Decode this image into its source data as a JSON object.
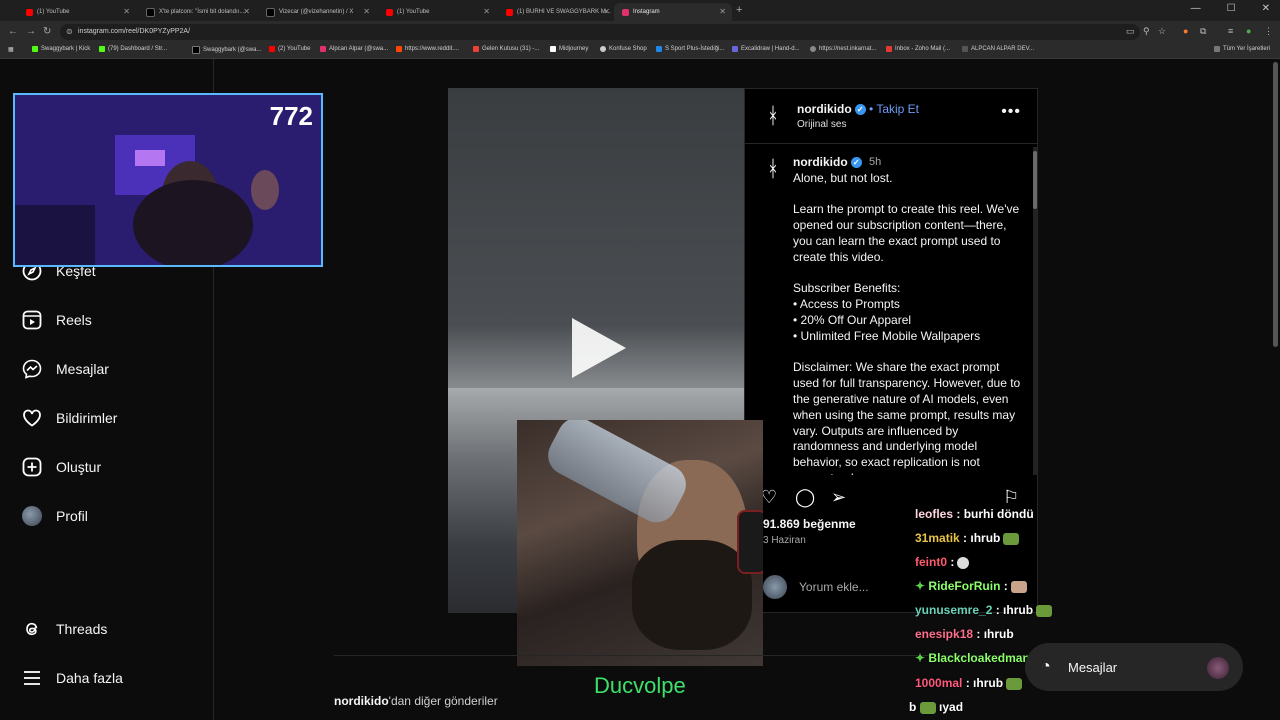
{
  "browser": {
    "tabs": [
      {
        "title": "(1) YouTube",
        "icon": "youtube-icon",
        "color": "#ff0000"
      },
      {
        "title": "X'te platconı: \"İsmi bit dolandıı...",
        "icon": "x-icon",
        "color": "#000000"
      },
      {
        "title": "Vizecar (@vizehannetin) / X",
        "icon": "x-icon",
        "color": "#000000"
      },
      {
        "title": "(1) YouTube",
        "icon": "youtube-icon",
        "color": "#ff0000"
      },
      {
        "title": "(1) BURHI VE SWAGGYBARK M...",
        "icon": "youtube-icon",
        "color": "#ff0000"
      },
      {
        "title": "Instagram",
        "icon": "instagram-icon",
        "color": "#e1306c"
      }
    ],
    "url": "instagram.com/reel/DK0PYZyPP2A/",
    "bookmarks": [
      {
        "label": "Swaggybark | Kick",
        "color": "#53fc18"
      },
      {
        "label": "(79) Dashboard / Str...",
        "color": "#53fc18"
      },
      {
        "label": "Swaggybark (@swa...",
        "color": "#000000"
      },
      {
        "label": "(2) YouTube",
        "color": "#ff0000"
      },
      {
        "label": "Alpcan Alpar (@swa...",
        "color": "#e1306c"
      },
      {
        "label": "https://www.reddit....",
        "color": "#ff4500"
      },
      {
        "label": "Gelen Kutusu (31) -...",
        "color": "#ea4335"
      },
      {
        "label": "Midjourney",
        "color": "#ffffff"
      },
      {
        "label": "Konfuse Shop",
        "color": "#cccccc"
      },
      {
        "label": "S Sport Plus-İstediği...",
        "color": "#1e88e5"
      },
      {
        "label": "Excalidraw | Hand-d...",
        "color": "#6965db"
      },
      {
        "label": "https://nest.inkarnat...",
        "color": "#888888"
      },
      {
        "label": "Inbox - Zoho Mail (...",
        "color": "#e53935"
      },
      {
        "label": "ALPCAN ALPAR DEV...",
        "color": "#555555"
      }
    ],
    "all_bookmarks": "Tüm Yer İşaretleri"
  },
  "sidebar": {
    "items": [
      {
        "label": "Keşfet",
        "icon": "compass-icon"
      },
      {
        "label": "Reels",
        "icon": "reels-icon"
      },
      {
        "label": "Mesajlar",
        "icon": "messenger-icon"
      },
      {
        "label": "Bildirimler",
        "icon": "heart-icon"
      },
      {
        "label": "Oluştur",
        "icon": "plus-square-icon"
      },
      {
        "label": "Profil",
        "icon": "avatar"
      }
    ],
    "threads": "Threads",
    "more": "Daha fazla"
  },
  "webcam": {
    "viewer_count": "772"
  },
  "post": {
    "username": "nordikido",
    "follow": "Takip Et",
    "audio": "Orijinal ses",
    "time": "5h",
    "caption": "Alone, but not lost.\n\nLearn the prompt to create this reel. We've opened our subscription content—there, you can learn the exact prompt used to create this video.\n\nSubscriber Benefits:\n• Access to Prompts\n• 20% Off Our Apparel\n• Unlimited Free Mobile Wallpapers\n\nDisclaimer: We share the exact prompt used for full transparency. However, due to the generative nature of AI models, even when using the same prompt, results may vary. Outputs are influenced by randomness and underlying model behavior, so exact replication is not guaranteed.",
    "likes": "91.869 beğenme",
    "date": "3 Haziran",
    "comment_placeholder": "Yorum ekle..."
  },
  "more_posts": {
    "user": "nordikido",
    "suffix": "'dan diğer gönderiler"
  },
  "streamer_name": "Ducvolpe",
  "chat": [
    {
      "user": "leofles",
      "color": "#ffd6e0",
      "msg": ": burhi döndü",
      "emote": ""
    },
    {
      "user": "31matik",
      "color": "#e8c547",
      "msg": ": ıhrub",
      "emote": "#6a9a3a"
    },
    {
      "user": "feint0",
      "color": "#ff5a6e",
      "msg": ":",
      "emote": "#dddddd"
    },
    {
      "user": "RideForRuin",
      "color": "#8aff6a",
      "msg": ":",
      "emote": "#c9a48a",
      "badge": true
    },
    {
      "user": "yunusemre_2",
      "color": "#6ad0b8",
      "msg": ": ıhrub",
      "emote": "#6a9a3a"
    },
    {
      "user": "enesipk18",
      "color": "#ff6e8a",
      "msg": ": ıhrub",
      "emote": ""
    },
    {
      "user": "Blackcloakedman",
      "color": "#8aff6a",
      "msg": ":",
      "emote": "#6a9a3a",
      "badge": true
    },
    {
      "user": "1000mal",
      "color": "#ff5a7e",
      "msg": ": ıhrub",
      "emote": "#6a9a3a"
    },
    {
      "user": "b",
      "color": "#ffffff",
      "msg": "ıyad",
      "emote": "#6a9a3a"
    }
  ],
  "messages_pill": "Mesajlar"
}
